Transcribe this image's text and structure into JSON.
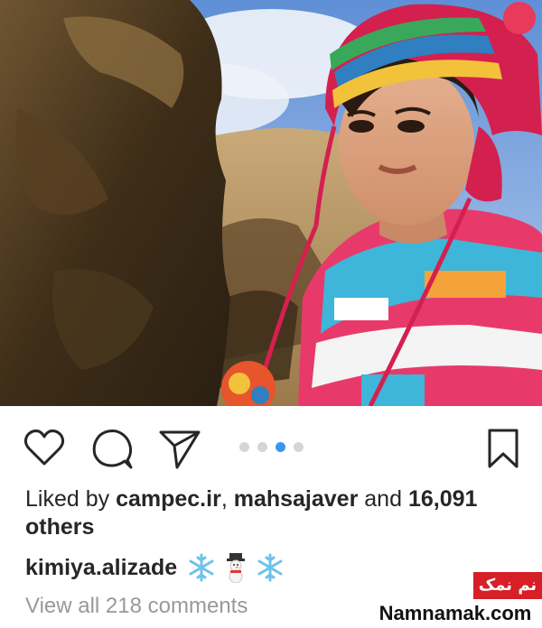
{
  "post": {
    "photo_icon": "selfie-photo",
    "carousel": {
      "total": 4,
      "active_index": 3
    }
  },
  "actions": {
    "like_icon": "heart-icon",
    "comment_icon": "comment-icon",
    "share_icon": "send-icon",
    "save_icon": "bookmark-icon"
  },
  "likes": {
    "prefix": "Liked by ",
    "user1": "campec.ir",
    "separator": ", ",
    "user2": "mahsajaver",
    "middle": " and ",
    "count": "16,091",
    "suffix": " others"
  },
  "caption": {
    "username": "kimiya.alizade",
    "emojis": [
      "snowflake-icon",
      "snowman-icon",
      "snowflake-icon"
    ]
  },
  "comments": {
    "view_all": "View all 218 comments"
  },
  "watermark": {
    "logo_text": "نم نمک",
    "site": "Namnamak.com"
  },
  "colors": {
    "text": "#262626",
    "muted": "#999999",
    "active_dot": "#3897f0",
    "inactive_dot": "#d5d5d5",
    "watermark_red": "#d61f26"
  }
}
